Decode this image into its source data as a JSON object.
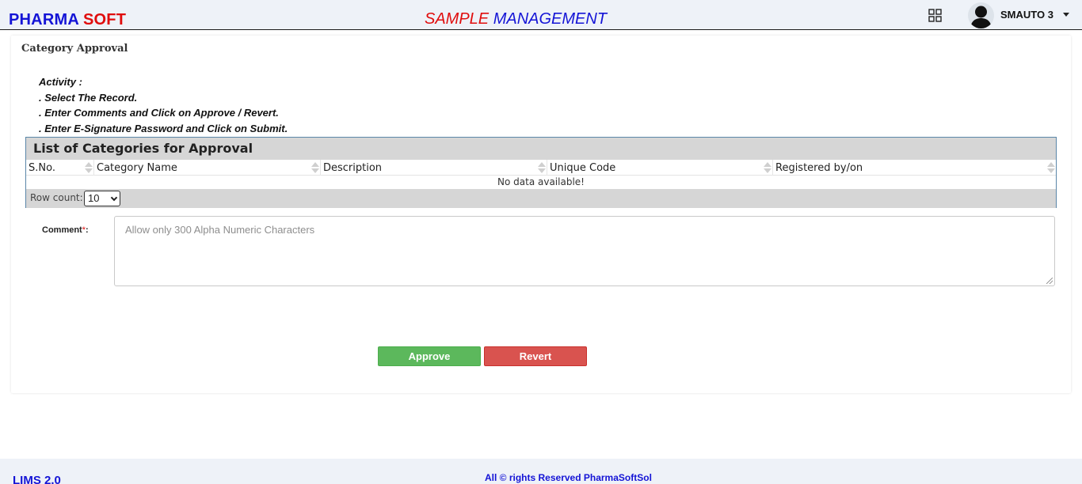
{
  "header": {
    "brand_part1": "PHARMA",
    "brand_part2": "SOFT",
    "title_part1": "SAMPLE",
    "title_part2": "MANAGEMENT",
    "apps_icon": "grid-icon",
    "user_name": "SMAUTO 3"
  },
  "page": {
    "title": "Category Approval",
    "activity_heading": "Activity :",
    "activity_steps": [
      ". Select The Record.",
      ". Enter Comments and Click on Approve / Revert.",
      ". Enter E-Signature Password and Click on Submit."
    ]
  },
  "grid": {
    "caption": "List of Categories for Approval",
    "columns": [
      "S.No.",
      "Category Name",
      "Description",
      "Unique Code",
      "Registered by/on"
    ],
    "empty_message": "No data available!",
    "row_count_label": "Row count:",
    "row_count_value": "10"
  },
  "comment": {
    "label": "Comment",
    "required_mark": "*",
    "suffix": ":",
    "placeholder": "Allow only 300 Alpha Numeric Characters"
  },
  "buttons": {
    "approve": "Approve",
    "revert": "Revert"
  },
  "footer": {
    "version": "LIMS 2.0",
    "copyright": "All © rights Reserved PharmaSoftSol"
  },
  "colors": {
    "brand_blue": "#1414d6",
    "brand_red": "#e00d0d",
    "approve_green": "#5cb85c",
    "revert_red": "#d9534f"
  }
}
